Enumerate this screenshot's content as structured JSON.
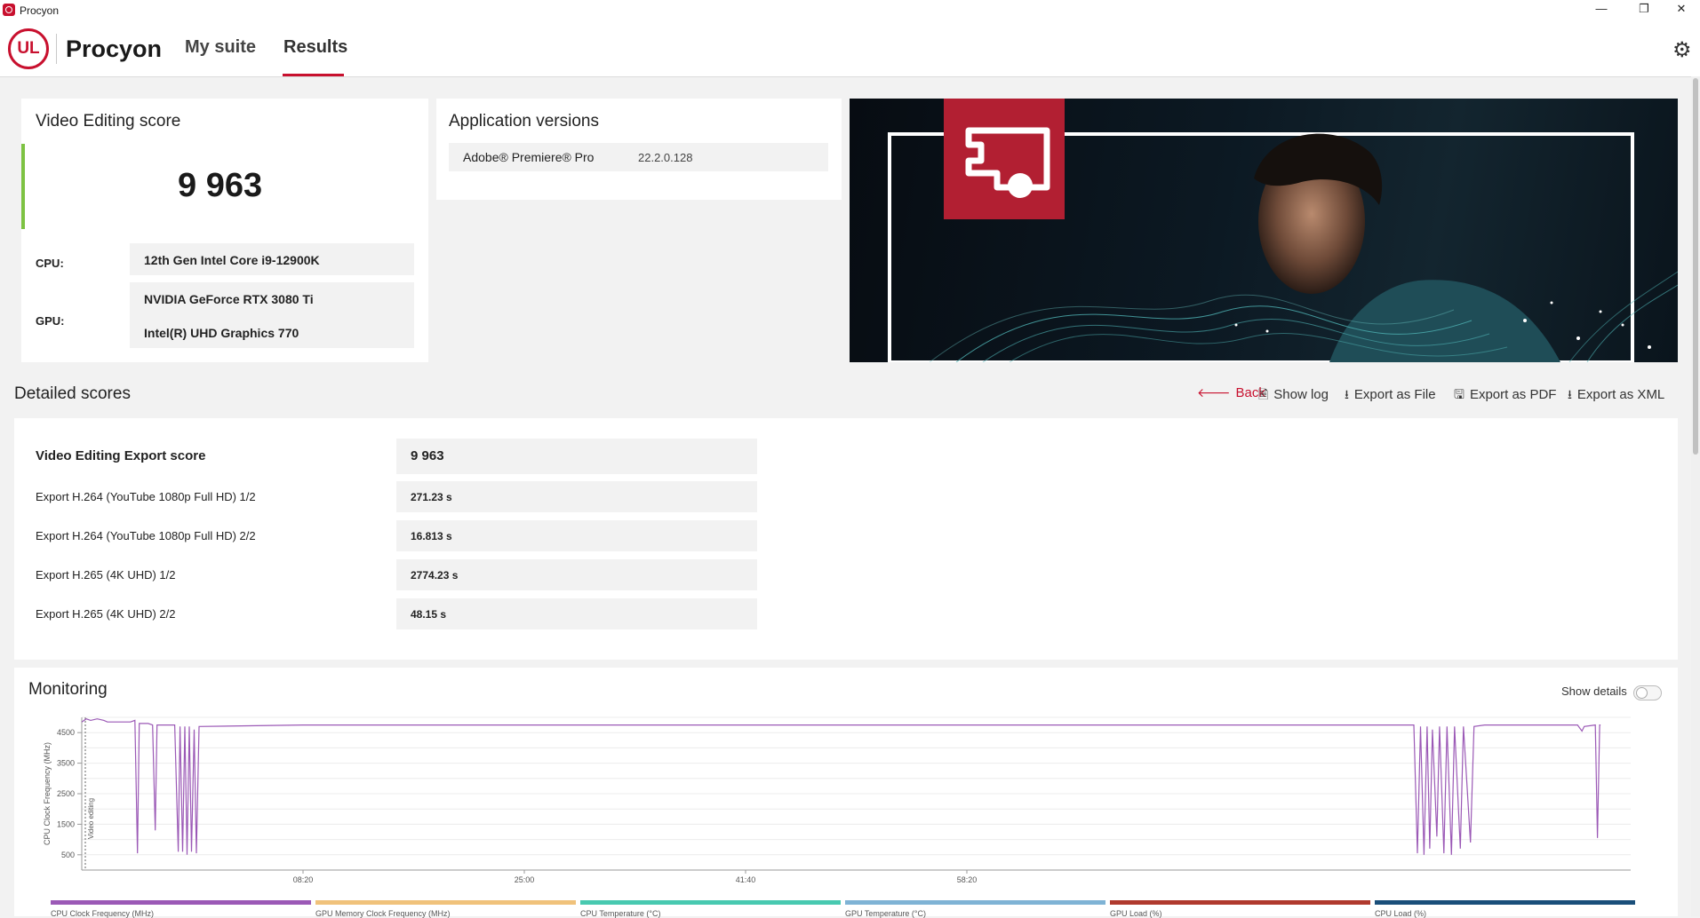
{
  "window": {
    "title": "Procyon",
    "minimize": "—",
    "maximize": "❐",
    "close": "✕"
  },
  "header": {
    "logo_text": "UL",
    "brand": "Procyon",
    "tabs": [
      "My suite",
      "Results"
    ],
    "active_tab": "Results"
  },
  "score_card": {
    "title": "Video Editing score",
    "score": "9 963",
    "cpu_label": "CPU:",
    "cpu_value": "12th Gen Intel Core i9-12900K",
    "gpu_label": "GPU:",
    "gpu_values": [
      "NVIDIA GeForce RTX 3080 Ti",
      "Intel(R) UHD Graphics 770"
    ]
  },
  "app_versions": {
    "title": "Application versions",
    "apps": [
      {
        "name": "Adobe® Premiere® Pro",
        "version": "22.2.0.128"
      }
    ]
  },
  "detailed": {
    "title": "Detailed scores",
    "actions": [
      "Back",
      "Show log",
      "Export as File",
      "Export as PDF",
      "Export as XML"
    ],
    "rows": [
      {
        "name": "Video Editing Export score",
        "value": "9 963"
      },
      {
        "name": "Export H.264 (YouTube 1080p Full HD) 1/2",
        "value": "271.23 s"
      },
      {
        "name": "Export H.264 (YouTube 1080p Full HD) 2/2",
        "value": "16.813 s"
      },
      {
        "name": "Export H.265 (4K UHD) 1/2",
        "value": "2774.23 s"
      },
      {
        "name": "Export H.265 (4K UHD) 2/2",
        "value": "48.15 s"
      }
    ]
  },
  "monitoring": {
    "title": "Monitoring",
    "show_details_label": "Show details",
    "show_details_on": false,
    "legend": [
      {
        "name": "CPU Clock Frequency (MHz)",
        "color": "#9b59b6"
      },
      {
        "name": "GPU Memory Clock Frequency (MHz)",
        "color": "#f0c27b"
      },
      {
        "name": "CPU Temperature (°C)",
        "color": "#48c9b0"
      },
      {
        "name": "GPU Temperature (°C)",
        "color": "#7fb3d5"
      },
      {
        "name": "GPU Load (%)",
        "color": "#b03a2e"
      },
      {
        "name": "CPU Load (%)",
        "color": "#1a4f7a"
      }
    ]
  },
  "chart_data": {
    "type": "line",
    "ylabel": "CPU Clock Frequency (MHz)",
    "band_label": "Video editing",
    "yticks": [
      500,
      1500,
      2500,
      3500,
      4500
    ],
    "ylim": [
      0,
      5000
    ],
    "xticks": [
      "08:20",
      "25:00",
      "41:40",
      "58:20"
    ],
    "xlim_seconds": [
      0,
      3500
    ],
    "grid": true,
    "series": [
      {
        "name": "CPU Clock Frequency (MHz)",
        "color": "#9b59b6",
        "points": [
          [
            0,
            4850
          ],
          [
            10,
            4950
          ],
          [
            20,
            4900
          ],
          [
            35,
            4950
          ],
          [
            50,
            4900
          ],
          [
            58,
            4850
          ],
          [
            110,
            4850
          ],
          [
            120,
            4900
          ],
          [
            126,
            550
          ],
          [
            130,
            4800
          ],
          [
            150,
            4800
          ],
          [
            160,
            4750
          ],
          [
            166,
            1300
          ],
          [
            170,
            4750
          ],
          [
            210,
            4750
          ],
          [
            218,
            600
          ],
          [
            222,
            4700
          ],
          [
            228,
            600
          ],
          [
            233,
            4700
          ],
          [
            238,
            500
          ],
          [
            243,
            4700
          ],
          [
            248,
            600
          ],
          [
            254,
            4600
          ],
          [
            259,
            550
          ],
          [
            265,
            4700
          ],
          [
            500,
            4750
          ],
          [
            850,
            4750
          ],
          [
            1300,
            4750
          ],
          [
            1800,
            4750
          ],
          [
            2400,
            4750
          ],
          [
            2900,
            4750
          ],
          [
            3010,
            4750
          ],
          [
            3018,
            550
          ],
          [
            3025,
            4700
          ],
          [
            3033,
            500
          ],
          [
            3040,
            4700
          ],
          [
            3046,
            700
          ],
          [
            3052,
            4600
          ],
          [
            3062,
            1100
          ],
          [
            3068,
            4700
          ],
          [
            3078,
            550
          ],
          [
            3085,
            4700
          ],
          [
            3095,
            500
          ],
          [
            3102,
            4700
          ],
          [
            3115,
            700
          ],
          [
            3122,
            4700
          ],
          [
            3138,
            900
          ],
          [
            3146,
            4700
          ],
          [
            3170,
            4750
          ],
          [
            3300,
            4750
          ],
          [
            3380,
            4750
          ],
          [
            3390,
            4550
          ],
          [
            3395,
            4700
          ],
          [
            3420,
            4750
          ],
          [
            3425,
            1050
          ],
          [
            3430,
            4750
          ],
          [
            3432,
            4750
          ]
        ]
      }
    ]
  }
}
